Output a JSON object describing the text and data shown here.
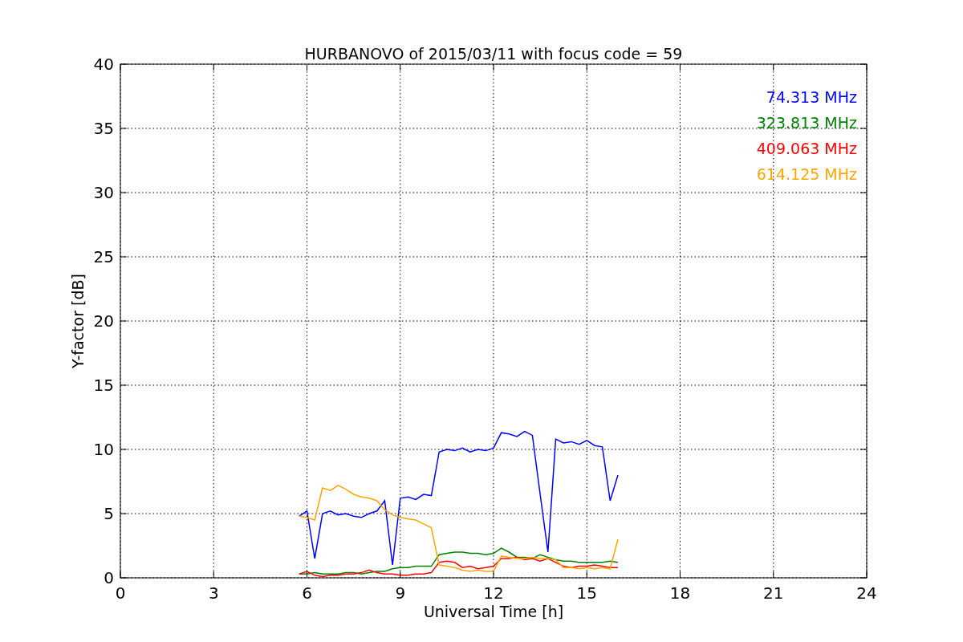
{
  "chart_data": {
    "type": "line",
    "title": "HURBANOVO of 2015/03/11 with focus code = 59",
    "xlabel": "Universal Time [h]",
    "ylabel": "Y-factor [dB]",
    "x": [
      5.75,
      6.0,
      6.25,
      6.5,
      6.75,
      7.0,
      7.25,
      7.5,
      7.75,
      8.0,
      8.25,
      8.5,
      8.75,
      9.0,
      9.25,
      9.5,
      9.75,
      10.0,
      10.25,
      10.5,
      10.75,
      11.0,
      11.25,
      11.5,
      11.75,
      12.0,
      12.25,
      12.5,
      12.75,
      13.0,
      13.25,
      13.5,
      13.75,
      14.0,
      14.25,
      14.5,
      14.75,
      15.0,
      15.25,
      15.5,
      15.75,
      16.0
    ],
    "series": [
      {
        "name": "74.313 MHz",
        "color": "#0000ff",
        "values": [
          4.8,
          5.2,
          1.5,
          5.0,
          5.2,
          4.9,
          5.0,
          4.8,
          4.7,
          5.0,
          5.2,
          6.0,
          1.0,
          6.2,
          6.3,
          6.1,
          6.5,
          6.4,
          9.8,
          10.0,
          9.9,
          10.1,
          9.8,
          10.0,
          9.9,
          10.1,
          11.3,
          11.2,
          11.0,
          11.4,
          11.1,
          6.5,
          2.0,
          10.8,
          10.5,
          10.6,
          10.4,
          10.7,
          10.3,
          10.2,
          6.0,
          8.0
        ]
      },
      {
        "name": "323.813 MHz",
        "color": "#008000",
        "values": [
          0.3,
          0.3,
          0.4,
          0.3,
          0.3,
          0.3,
          0.4,
          0.4,
          0.3,
          0.4,
          0.5,
          0.5,
          0.7,
          0.8,
          0.8,
          0.9,
          0.9,
          0.9,
          1.8,
          1.9,
          2.0,
          2.0,
          1.9,
          1.9,
          1.8,
          1.9,
          2.3,
          2.0,
          1.6,
          1.6,
          1.5,
          1.8,
          1.6,
          1.4,
          1.3,
          1.3,
          1.2,
          1.2,
          1.2,
          1.2,
          1.3,
          1.2
        ]
      },
      {
        "name": "409.063 MHz",
        "color": "#ff0000",
        "values": [
          0.3,
          0.5,
          0.2,
          0.1,
          0.2,
          0.2,
          0.3,
          0.3,
          0.4,
          0.6,
          0.4,
          0.3,
          0.3,
          0.2,
          0.2,
          0.3,
          0.3,
          0.4,
          1.2,
          1.3,
          1.2,
          0.8,
          0.9,
          0.7,
          0.8,
          0.9,
          1.5,
          1.5,
          1.6,
          1.4,
          1.5,
          1.3,
          1.5,
          1.2,
          0.9,
          0.8,
          0.9,
          0.9,
          1.0,
          0.9,
          0.8,
          0.8
        ]
      },
      {
        "name": "614.125 MHz",
        "color": "#ffa500",
        "values": [
          4.8,
          4.7,
          4.5,
          7.0,
          6.8,
          7.2,
          6.9,
          6.5,
          6.3,
          6.2,
          6.0,
          5.3,
          4.9,
          4.7,
          4.6,
          4.5,
          4.2,
          3.9,
          1.0,
          0.9,
          0.8,
          0.6,
          0.5,
          0.6,
          0.5,
          0.5,
          1.7,
          1.6,
          1.5,
          1.5,
          1.6,
          1.5,
          1.5,
          1.4,
          0.8,
          0.8,
          0.7,
          0.8,
          0.7,
          0.8,
          0.7,
          3.0
        ]
      }
    ],
    "xlim": [
      0,
      24
    ],
    "ylim": [
      0,
      40
    ],
    "xticks": [
      0,
      3,
      6,
      9,
      12,
      15,
      18,
      21,
      24
    ],
    "yticks": [
      0,
      5,
      10,
      15,
      20,
      25,
      30,
      35,
      40
    ],
    "grid": true
  }
}
